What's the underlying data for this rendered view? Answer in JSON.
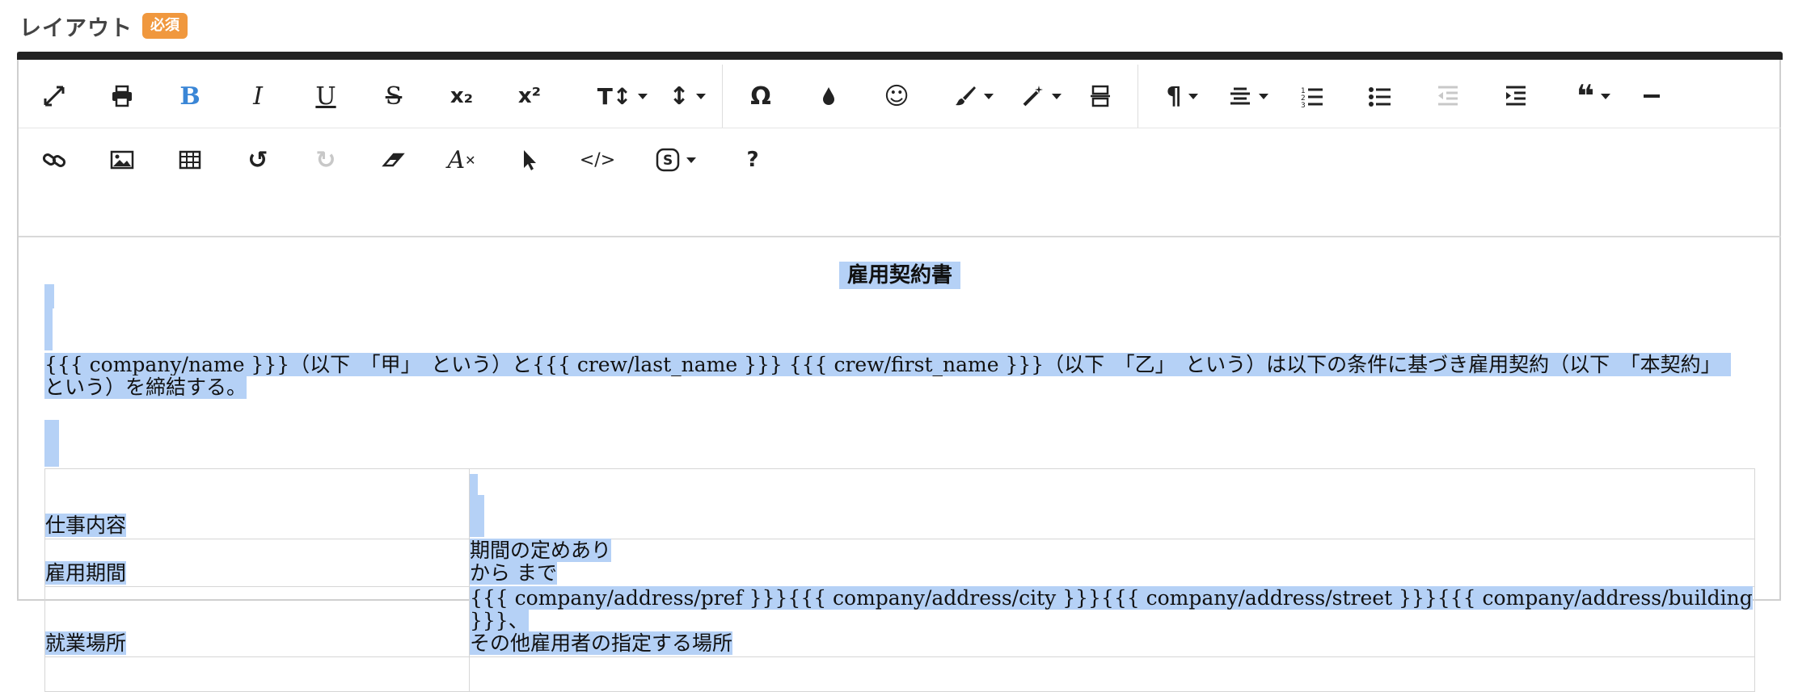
{
  "header": {
    "title": "レイアウト",
    "badge": "必須"
  },
  "toolbar": {
    "row1": [
      {
        "name": "fullscreen-icon",
        "label": "⤢"
      },
      {
        "name": "print-icon",
        "label": "🖶"
      },
      {
        "name": "bold-icon",
        "label": "B"
      },
      {
        "name": "italic-icon",
        "label": "I"
      },
      {
        "name": "underline-icon",
        "label": "U"
      },
      {
        "name": "strikethrough-icon",
        "label": "S"
      },
      {
        "name": "subscript-icon",
        "label": "x₂"
      },
      {
        "name": "superscript-icon",
        "label": "x²"
      },
      {
        "name": "font-size-icon",
        "label": "T↕"
      },
      {
        "name": "line-height-icon",
        "label": "↕"
      },
      {
        "name": "special-char-icon",
        "label": "Ω"
      },
      {
        "name": "text-color-icon",
        "label": "●"
      },
      {
        "name": "emoji-icon",
        "label": "☺"
      },
      {
        "name": "paint-brush-icon",
        "label": "🖌"
      },
      {
        "name": "magic-wand-icon",
        "label": "✨"
      },
      {
        "name": "page-break-icon",
        "label": "⧉"
      },
      {
        "name": "paragraph-format-icon",
        "label": "¶"
      },
      {
        "name": "align-icon",
        "label": "≡"
      },
      {
        "name": "ordered-list-icon",
        "label": "1≡"
      },
      {
        "name": "unordered-list-icon",
        "label": "•≡"
      },
      {
        "name": "outdent-icon",
        "label": "⇤"
      },
      {
        "name": "indent-icon",
        "label": "⇥"
      },
      {
        "name": "quote-icon",
        "label": "❝"
      },
      {
        "name": "horizontal-line-icon",
        "label": "—"
      }
    ],
    "row2": [
      {
        "name": "link-icon",
        "label": "🔗"
      },
      {
        "name": "image-icon",
        "label": "🖼"
      },
      {
        "name": "table-icon",
        "label": "▦"
      },
      {
        "name": "undo-icon",
        "label": "↺"
      },
      {
        "name": "redo-icon",
        "label": "↻"
      },
      {
        "name": "eraser-icon",
        "label": "⌫"
      },
      {
        "name": "clear-format-icon",
        "label": "A̸"
      },
      {
        "name": "select-pointer-icon",
        "label": "➤"
      },
      {
        "name": "code-view-icon",
        "label": "</>"
      },
      {
        "name": "symbol-icon",
        "label": "Ⓢ"
      },
      {
        "name": "help-icon",
        "label": "?"
      }
    ]
  },
  "doc": {
    "title": "雇用契約書",
    "paragraph": "{{{ company/name }}}（以下　「甲」　という）と{{{ crew/last_name }}} {{{ crew/first_name }}}（以下　「乙」　という）は以下の条件に基づき雇用契約（以下　「本契約」　という）を締結する。",
    "rows": [
      {
        "label": "仕事内容",
        "lines": []
      },
      {
        "label": "雇用期間",
        "lines": [
          "期間の定めあり",
          "から まで"
        ]
      },
      {
        "label": "就業場所",
        "lines": [
          "{{{ company/address/pref }}}{{{ company/address/city }}}{{{ company/address/street }}}{{{ company/address/building }}}、",
          "その他雇用者の指定する場所"
        ]
      }
    ]
  },
  "colors": {
    "accent": "#f0983e",
    "selection": "#b5d1f6",
    "boldBlue": "#3a86d6"
  }
}
